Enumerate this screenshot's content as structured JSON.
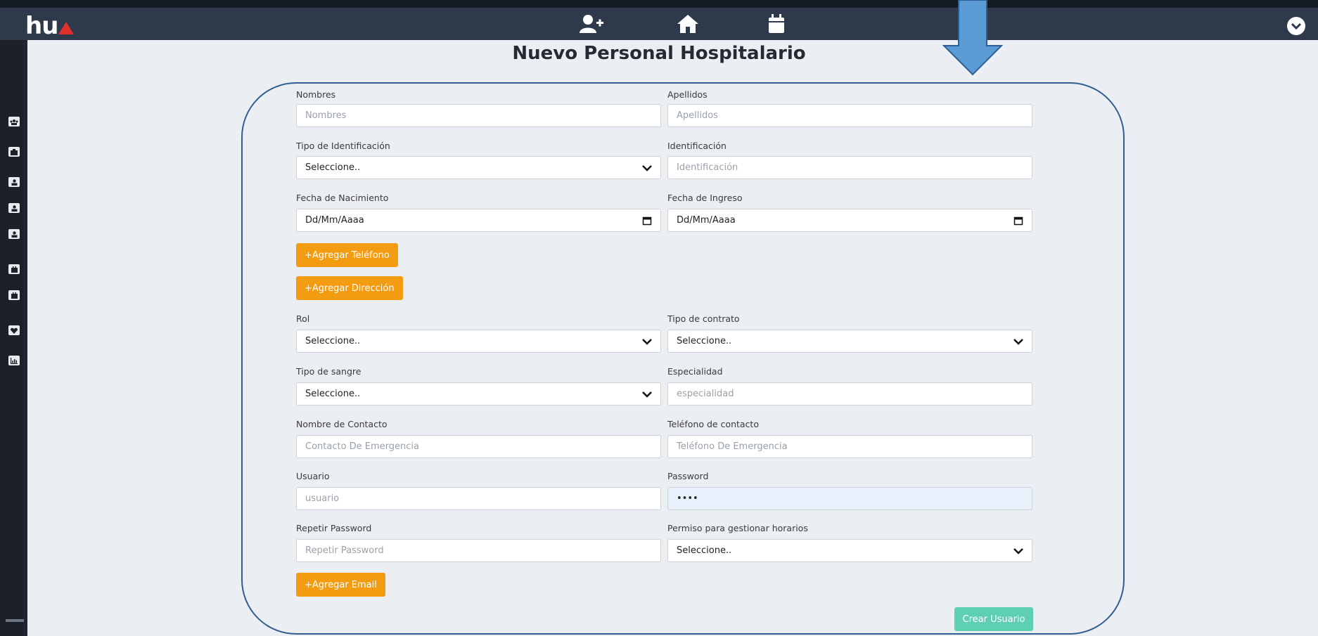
{
  "header": {
    "logo_text": "hu",
    "nav_icons": [
      "add-user-icon",
      "home-icon",
      "calendar-icon",
      "chevron-down-circle-icon"
    ],
    "colors": {
      "bar": "#2e3a4b",
      "logo_accent": "#e0302b"
    }
  },
  "sidebar": {
    "items": [
      "users-icon",
      "hospital-icon",
      "user-icon",
      "user-icon",
      "user-icon",
      "calendar-icon",
      "calendar-icon",
      "heart-icon",
      "chart-icon"
    ]
  },
  "page": {
    "title": "Nuevo Personal Hospitalario"
  },
  "form": {
    "nombres": {
      "label": "Nombres",
      "placeholder": "Nombres"
    },
    "apellidos": {
      "label": "Apellidos",
      "placeholder": "Apellidos"
    },
    "tipo_id": {
      "label": "Tipo de Identificación",
      "value": "Seleccione.."
    },
    "identificacion": {
      "label": "Identificación",
      "placeholder": "Identificación"
    },
    "fecha_nac": {
      "label": "Fecha de Nacimiento",
      "value": "Dd/Mm/Aaaa"
    },
    "fecha_ing": {
      "label": "Fecha de Ingreso",
      "value": "Dd/Mm/Aaaa"
    },
    "add_phone": "+Agregar Teléfono",
    "add_address": "+Agregar Dirección",
    "rol": {
      "label": "Rol",
      "value": "Seleccione.."
    },
    "tipo_contrato": {
      "label": "Tipo de contrato",
      "value": "Seleccione.."
    },
    "tipo_sangre": {
      "label": "Tipo de sangre",
      "value": "Seleccione.."
    },
    "especialidad": {
      "label": "Especialidad",
      "placeholder": "especialidad"
    },
    "nombre_contacto": {
      "label": "Nombre de Contacto",
      "placeholder": "Contacto De Emergencia"
    },
    "tel_contacto": {
      "label": "Teléfono de contacto",
      "placeholder": "Teléfono De Emergencia"
    },
    "usuario": {
      "label": "Usuario",
      "placeholder": "usuario"
    },
    "password": {
      "label": "Password",
      "value": "••••"
    },
    "repetir_password": {
      "label": "Repetir Password",
      "placeholder": "Repetir Password"
    },
    "permiso": {
      "label": "Permiso para gestionar horarios",
      "value": "Seleccione.."
    },
    "add_email": "+Agregar Email",
    "submit": "Crear Usuario",
    "colors": {
      "orange": "#f39c12",
      "submit": "#5fcfb3",
      "frame": "#2f5f91"
    }
  }
}
